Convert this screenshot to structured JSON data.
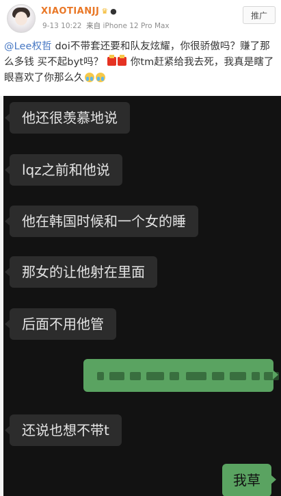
{
  "post": {
    "username": "XIAOTIANJJ",
    "crown_icon": "crown-icon",
    "panda_icon": "panda-icon",
    "timestamp": "9-13 10:22",
    "source_prefix": "来自",
    "device": "iPhone 12 Pro Max",
    "promote_label": "推广",
    "mention": "@Lee权哲",
    "text_part1": " doi不带套还要和队友炫耀，你很骄傲吗？赚了那么多钱 买不起byt吗？",
    "text_part2": "你tm赶紧给我去死，我真是瞎了眼喜欢了你那么久"
  },
  "chat": {
    "messages": [
      {
        "side": "in",
        "text": "他还很羡慕地说"
      },
      {
        "side": "in",
        "text": "lqz之前和他说"
      },
      {
        "side": "in",
        "text": "他在韩国时候和一个女的睡"
      },
      {
        "side": "in",
        "text": "那女的让他射在里面"
      },
      {
        "side": "in",
        "text": "后面不用他管"
      },
      {
        "side": "out",
        "text": ""
      },
      {
        "side": "in",
        "text": "还说也想不带t"
      },
      {
        "side": "out",
        "text": "我草"
      }
    ]
  },
  "colors": {
    "username": "#e97726",
    "mention": "#4677c3",
    "chat_background": "#121212",
    "incoming_bubble": "#2c2c2c",
    "outgoing_bubble": "#5aa361"
  }
}
